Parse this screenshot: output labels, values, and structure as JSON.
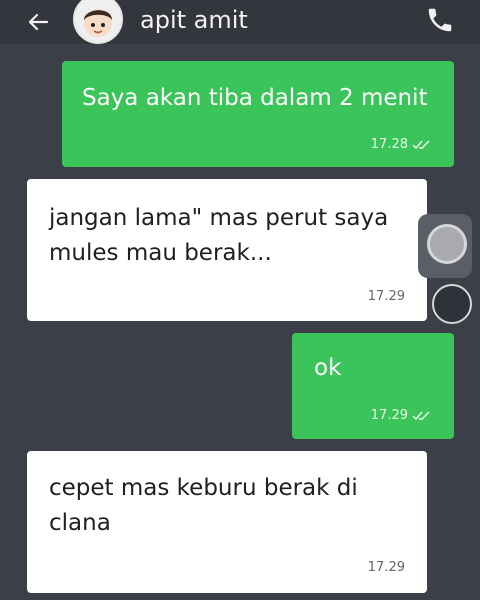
{
  "header": {
    "contact_name": "apit amit",
    "back_icon": "arrow-left-icon",
    "call_icon": "phone-icon",
    "avatar_icon": "cartoon-avatar"
  },
  "messages": [
    {
      "direction": "outgoing",
      "text": "Saya akan tiba dalam 2 menit",
      "time": "17.28",
      "status": "double-check-icon"
    },
    {
      "direction": "incoming",
      "line1": "jangan lama\" mas perut saya",
      "line2": "mules mau berak...",
      "time": "17.29"
    },
    {
      "direction": "outgoing",
      "text": "ok",
      "time": "17.29",
      "status": "double-check-icon"
    },
    {
      "direction": "incoming",
      "line1": "cepet mas keburu berak di",
      "line2": "clana",
      "time": "17.29"
    }
  ],
  "colors": {
    "background": "#3b3f48",
    "outgoing_bubble": "#3bc45a",
    "incoming_bubble": "#ffffff"
  }
}
